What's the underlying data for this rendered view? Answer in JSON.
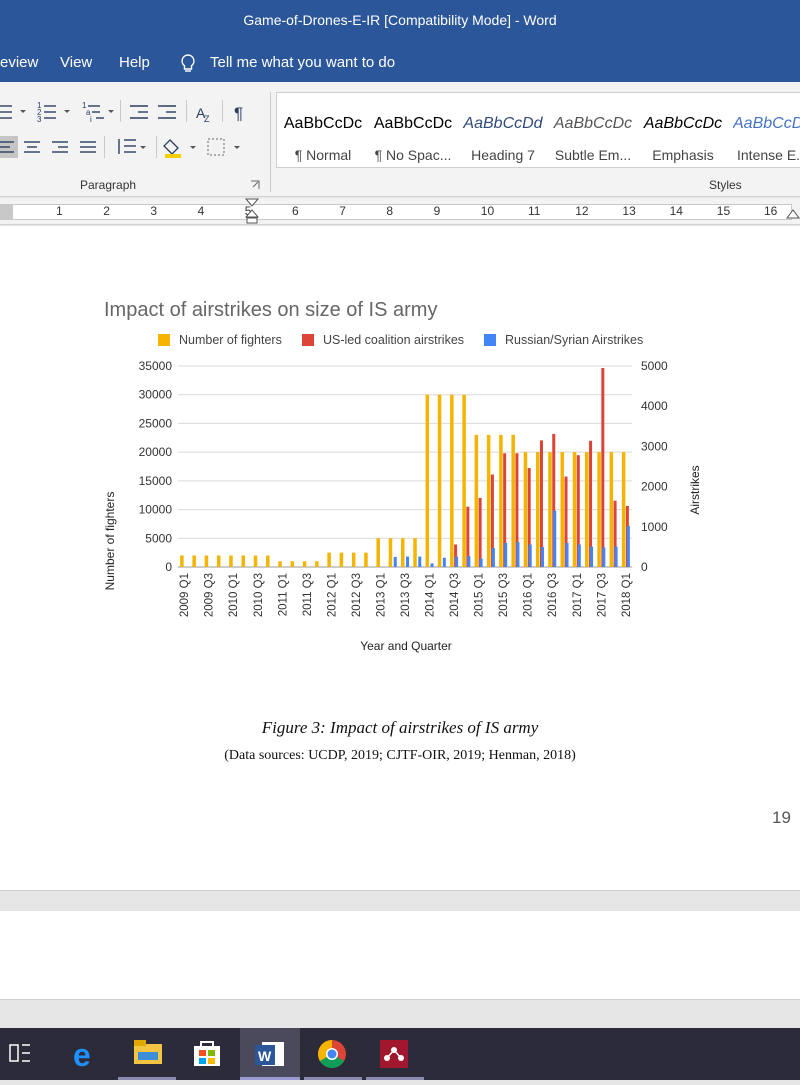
{
  "window": {
    "title": "Game-of-Drones-E-IR [Compatibility Mode]  -  Word"
  },
  "menu": {
    "items": [
      "eview",
      "View",
      "Help"
    ],
    "tell_me": "Tell me what you want to do"
  },
  "ribbon": {
    "paragraph_label": "Paragraph",
    "styles_label": "Styles",
    "styles": [
      {
        "preview": "AaBbCcDc",
        "name": "¶ Normal"
      },
      {
        "preview": "AaBbCcDc",
        "name": "¶ No Spac..."
      },
      {
        "preview": "AaBbCcDd",
        "name": "Heading 7"
      },
      {
        "preview": "AaBbCcDc",
        "name": "Subtle Em..."
      },
      {
        "preview": "AaBbCcDc",
        "name": "Emphasis"
      },
      {
        "preview": "AaBbCcDc",
        "name": "Intense E..."
      }
    ]
  },
  "ruler": {
    "numbers": [
      "1",
      "2",
      "3",
      "4",
      "5",
      "6",
      "7",
      "8",
      "9",
      "10",
      "11",
      "12",
      "13",
      "14",
      "15",
      "16"
    ]
  },
  "chart_data": {
    "type": "bar",
    "title": "Impact of airstrikes on size of IS army",
    "xlabel": "Year and Quarter",
    "ylabel": "Number of fighters",
    "y2label": "Airstrikes",
    "ylim": [
      0,
      35000
    ],
    "y2lim": [
      0,
      5000
    ],
    "yticks": [
      "0",
      "5000",
      "10000",
      "15000",
      "20000",
      "25000",
      "30000",
      "35000"
    ],
    "y2ticks": [
      "0",
      "1000",
      "2000",
      "3000",
      "4000",
      "5000"
    ],
    "legend_position": "top",
    "categories": [
      "2009 Q1",
      "2009 Q2",
      "2009 Q3",
      "2009 Q4",
      "2010 Q1",
      "2010 Q2",
      "2010 Q3",
      "2010 Q4",
      "2011 Q1",
      "2011 Q2",
      "2011 Q3",
      "2011 Q4",
      "2012 Q1",
      "2012 Q2",
      "2012 Q3",
      "2012 Q4",
      "2013 Q1",
      "2013 Q2",
      "2013 Q3",
      "2013 Q4",
      "2014 Q1",
      "2014 Q2",
      "2014 Q3",
      "2014 Q4",
      "2015 Q1",
      "2015 Q2",
      "2015 Q3",
      "2015 Q4",
      "2016 Q1",
      "2016 Q2",
      "2016 Q3",
      "2016 Q4",
      "2017 Q1",
      "2017 Q2",
      "2017 Q3",
      "2017 Q4",
      "2018 Q1"
    ],
    "tick_labels": [
      "2009 Q1",
      "2009 Q3",
      "2010 Q1",
      "2010 Q3",
      "2011 Q1",
      "2011 Q3",
      "2012 Q1",
      "2012 Q3",
      "2013 Q1",
      "2013 Q3",
      "2014 Q1",
      "2014 Q3",
      "2015 Q1",
      "2015 Q3",
      "2016 Q1",
      "2016 Q3",
      "2017 Q1",
      "2017 Q3",
      "2018 Q1"
    ],
    "series": [
      {
        "name": "Number of fighters",
        "color": "#f4b400",
        "axis": "left",
        "values": [
          2000,
          2000,
          2000,
          2000,
          2000,
          2000,
          2000,
          2000,
          1000,
          1000,
          1000,
          1000,
          2500,
          2500,
          2500,
          2500,
          5000,
          5000,
          5000,
          5000,
          30000,
          30000,
          30000,
          30000,
          23000,
          23000,
          23000,
          23000,
          20000,
          20000,
          20000,
          20000,
          20000,
          20000,
          20000,
          20000,
          20000
        ]
      },
      {
        "name": "US-led coalition airstrikes",
        "color": "#db4437",
        "axis": "right",
        "values": [
          0,
          0,
          0,
          0,
          0,
          0,
          0,
          0,
          0,
          0,
          0,
          0,
          0,
          0,
          0,
          0,
          0,
          0,
          0,
          0,
          0,
          0,
          560,
          1500,
          1720,
          2300,
          2830,
          2830,
          2460,
          3150,
          3310,
          2250,
          2780,
          3140,
          4950,
          1650,
          1520
        ]
      },
      {
        "name": "Russian/Syrian Airstrikes",
        "color": "#4285f4",
        "axis": "right",
        "values": [
          0,
          0,
          0,
          0,
          0,
          0,
          0,
          0,
          0,
          0,
          0,
          0,
          0,
          0,
          0,
          0,
          0,
          250,
          260,
          260,
          90,
          230,
          260,
          270,
          210,
          470,
          600,
          620,
          560,
          500,
          1400,
          600,
          560,
          510,
          490,
          510,
          1020
        ]
      }
    ]
  },
  "caption": {
    "figure": "Figure 3: Impact of airstrikes of IS army",
    "sources": "(Data sources: UCDP, 2019; CJTF-OIR, 2019; Henman, 2018)"
  },
  "page_number": "19",
  "taskbar": {
    "icons": [
      "task-view-icon",
      "edge-icon",
      "file-explorer-icon",
      "store-icon",
      "word-icon",
      "chrome-icon",
      "mendeley-icon"
    ]
  }
}
